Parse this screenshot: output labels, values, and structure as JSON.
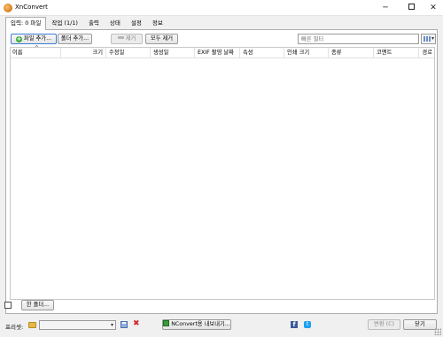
{
  "window": {
    "title": "XnConvert",
    "minimize": "─",
    "close": "✕"
  },
  "tabs": [
    {
      "label": "입력: 0 파일",
      "active": true
    },
    {
      "label": "작업 (1/1)",
      "active": false
    },
    {
      "label": "출력",
      "active": false
    },
    {
      "label": "상태",
      "active": false
    },
    {
      "label": "설정",
      "active": false
    },
    {
      "label": "정보",
      "active": false
    }
  ],
  "toolbar": {
    "add_files_label": "파일 추가...",
    "add_folder_label": "폴더 추가...",
    "remove_label": "제거",
    "remove_all_label": "모두 제거",
    "filter_placeholder": "빠른 필터"
  },
  "file_list": {
    "columns": [
      "이름",
      "크기",
      "수정일",
      "생성일",
      "EXIF 촬영 날짜",
      "속성",
      "인쇄 크기",
      "종류",
      "코멘트",
      "경로"
    ],
    "rows": []
  },
  "bottom": {
    "one_folder_label": "한 폴더..."
  },
  "footer": {
    "preset_label": "프리셋:",
    "preset_value": "",
    "export_label": "NConvert용 내보내기...",
    "convert_label": "변환 (C)",
    "close_label": "닫기",
    "facebook": "f",
    "twitter": "t"
  },
  "icons": {
    "app": "xnconvert-logo-icon",
    "add": "plus-icon",
    "remove": "minus-icon",
    "view": "grid-view-icon",
    "folder": "folder-icon",
    "save": "save-icon",
    "delete": "delete-icon"
  },
  "colors": {
    "accent_green": "#3caa3c",
    "delete_red": "#d02a2a",
    "facebook": "#3b5998",
    "twitter": "#1da1f2"
  }
}
